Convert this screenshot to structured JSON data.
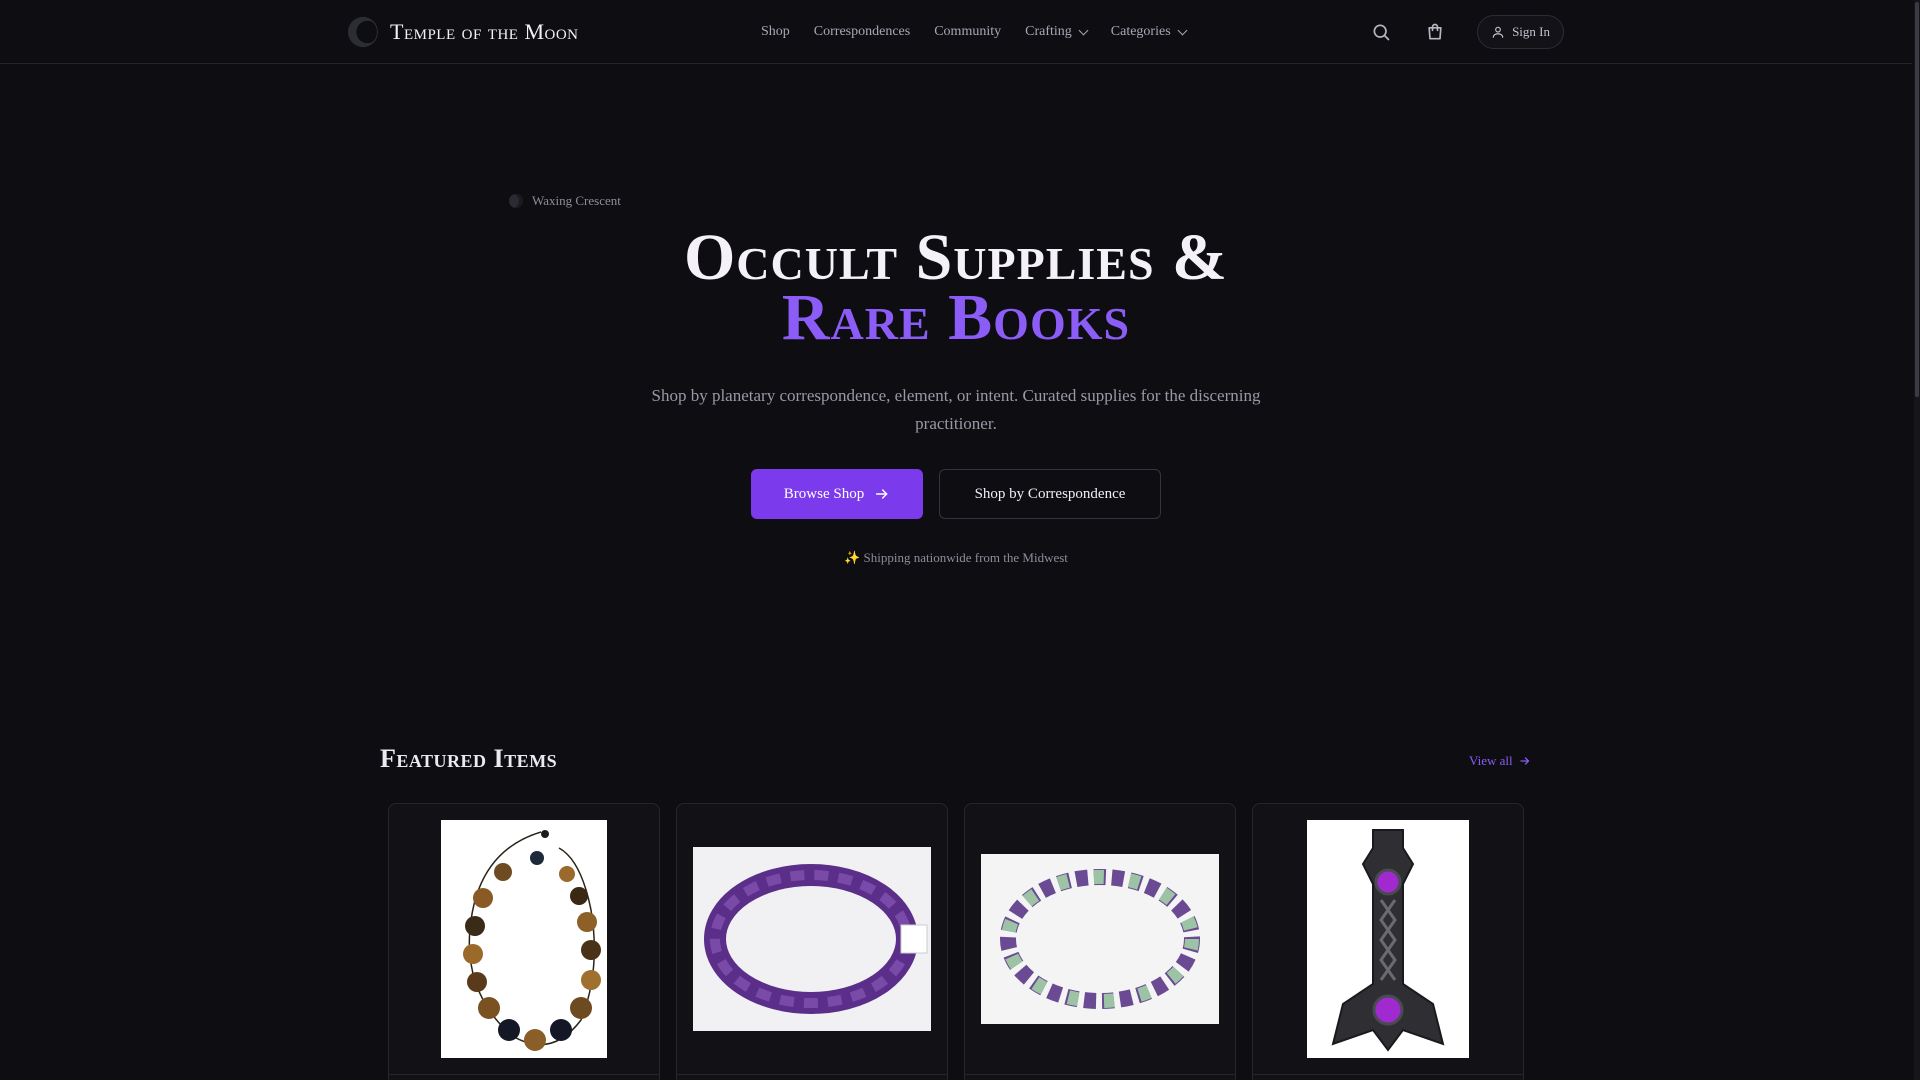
{
  "brand": {
    "name": "Temple of the Moon",
    "logo_icon": "moon-logo-icon"
  },
  "nav": {
    "items": [
      {
        "label": "Shop",
        "dropdown": false
      },
      {
        "label": "Correspondences",
        "dropdown": false
      },
      {
        "label": "Community",
        "dropdown": false
      },
      {
        "label": "Crafting",
        "dropdown": true
      },
      {
        "label": "Categories",
        "dropdown": true
      }
    ]
  },
  "header_actions": {
    "search_icon": "search-icon",
    "cart_icon": "shopping-bag-icon",
    "signin_label": "Sign In",
    "signin_icon": "user-icon"
  },
  "hero": {
    "moon_phase": "Waxing Crescent",
    "title_line1": "Occult Supplies &",
    "title_line2": "Rare Books",
    "subtitle": "Shop by planetary correspondence, element, or intent. Curated supplies for the discerning practitioner.",
    "primary_button": "Browse Shop",
    "secondary_button": "Shop by Correspondence",
    "shipping_note": "Shipping nationwide from the Midwest",
    "shipping_icon": "✨"
  },
  "featured": {
    "title": "Featured Items",
    "view_all": "View all",
    "items": [
      {
        "image": "tiger-eye-bead-bracelet"
      },
      {
        "image": "amethyst-tumbled-bracelet"
      },
      {
        "image": "amethyst-aventurine-bracelet"
      },
      {
        "image": "thors-hammer-pendant"
      }
    ]
  },
  "colors": {
    "background": "#0e0e12",
    "accent": "#8b5cf6",
    "primary_button": "#7c3aed",
    "text": "#e8e6ef",
    "muted": "#9a98a6"
  }
}
